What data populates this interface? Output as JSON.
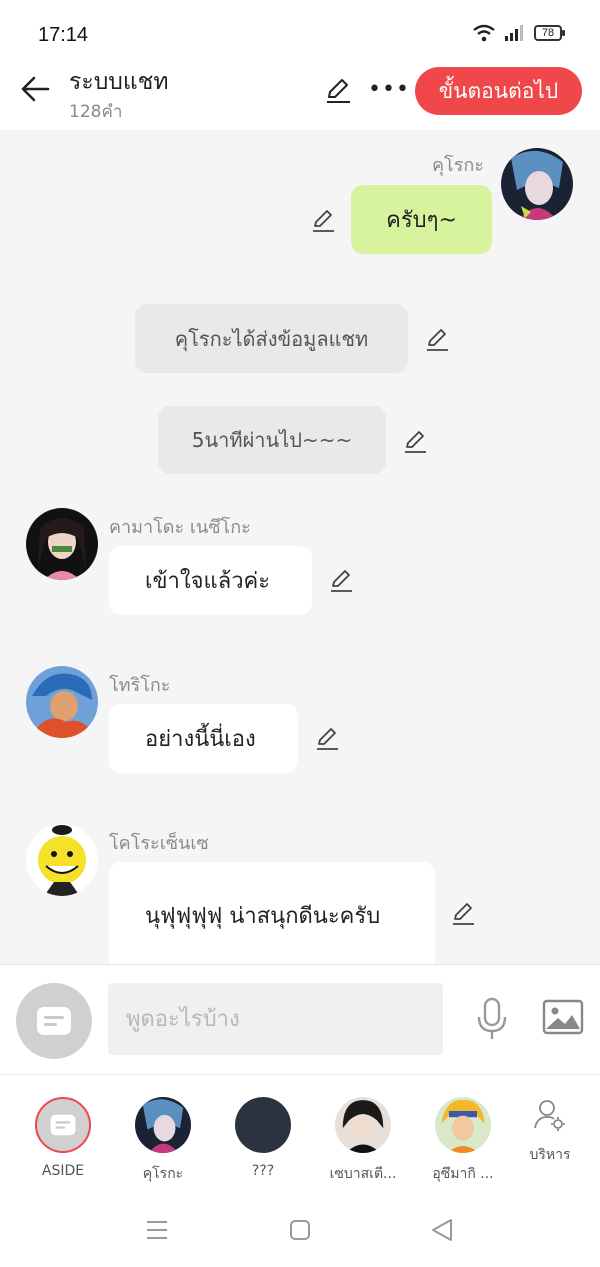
{
  "status": {
    "time": "17:14",
    "battery": "78"
  },
  "header": {
    "title": "ระบบแชท",
    "word_count": "128คำ",
    "next_label": "ขั้นตอนต่อไป"
  },
  "messages": [
    {
      "type": "self",
      "name": "คุโรกะ",
      "text": "ครับๆ~"
    },
    {
      "type": "system",
      "text": "คุโรกะได้ส่งข้อมูลแชท"
    },
    {
      "type": "system",
      "text": "5นาทีผ่านไป~~~"
    },
    {
      "type": "other",
      "name": "คามาโดะ เนซึโกะ",
      "text": "เข้าใจแล้วค่ะ"
    },
    {
      "type": "other",
      "name": "โทริโกะ",
      "text": "อย่างนี้นี่เอง"
    },
    {
      "type": "other",
      "name": "โคโระเซ็นเซ",
      "text": "นุฟุฟุฟุฟุ น่าสนุกดีนะครับ"
    }
  ],
  "input": {
    "placeholder": "พูดอะไรบ้าง"
  },
  "characters": [
    {
      "label": "ASIDE"
    },
    {
      "label": "คุโรกะ"
    },
    {
      "label": "???"
    },
    {
      "label": "เซบาสเตี..."
    },
    {
      "label": "อุซึมากิ ..."
    }
  ],
  "admin_label": "บริหาร",
  "colors": {
    "accent": "#f0484a",
    "self_bubble": "#d8f39d",
    "background": "#f5f5f5"
  }
}
